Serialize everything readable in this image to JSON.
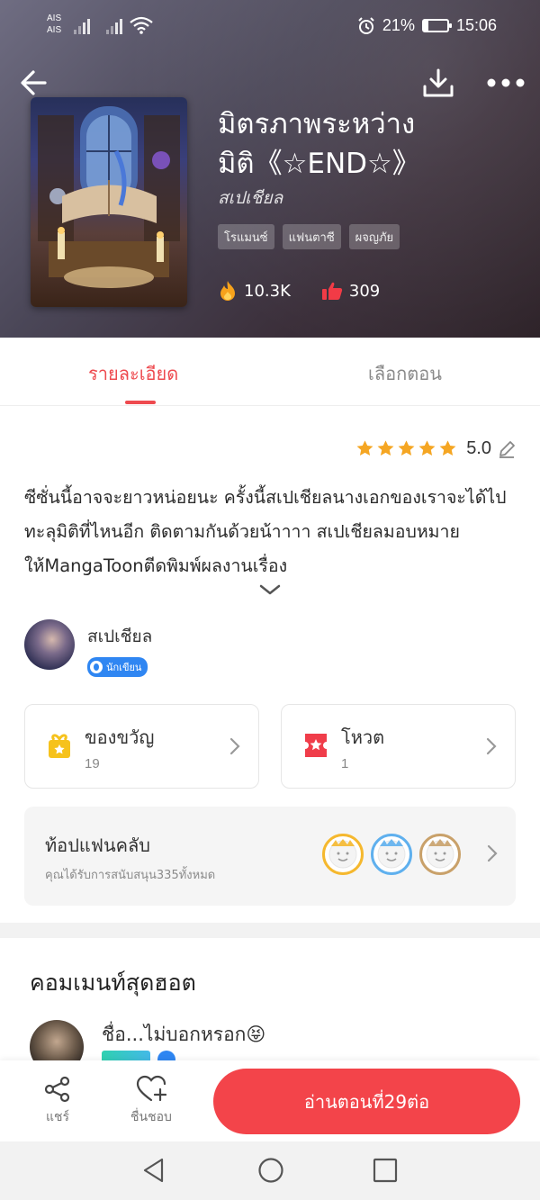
{
  "status_bar": {
    "carrier_1": "AIS",
    "carrier_2": "AIS",
    "battery": "21%",
    "battery_level": 0.21,
    "time": "15:06"
  },
  "header": {
    "back_icon": "back-arrow-icon",
    "download_icon": "download-icon",
    "more_icon": "more-icon"
  },
  "book": {
    "title_line1": "มิตรภาพระหว่าง",
    "title_line2": "มิติ《☆END☆》",
    "author": "สเปเชียล",
    "tags": [
      "โรแมนซ์",
      "แฟนตาซี",
      "ผจญภัย"
    ],
    "views": "10.3K",
    "likes": "309"
  },
  "tabs": {
    "details": "รายละเอียด",
    "episodes": "เลือกตอน"
  },
  "details": {
    "rating": "5.0",
    "rating_stars": 5,
    "description": "ซีซั่นนี้อาจจะยาวหน่อยนะ ครั้งนี้สเปเชียลนางเอกของเราจะได้ไปทะลุมิติที่ไหนอีก ติดตามกันด้วยน้าาาา สเปเชียลมอบหมายให้MangaToonตีดพิมพ์ผลงานเรื่อง"
  },
  "author_info": {
    "name": "สเปเชียล",
    "badge": "นักเขียน"
  },
  "cards": {
    "gift_label": "ของขวัญ",
    "gift_count": "19",
    "vote_label": "โหวต",
    "vote_count": "1"
  },
  "fanclub": {
    "title": "ท้อปแฟนคลับ",
    "subtitle": "คุณได้รับการสนับสนุน335ทั้งหมด"
  },
  "comments": {
    "title": "คอมเมนท์สุดฮอต",
    "first_comment": "ชื่อ...ไม่บอกหรอก😝"
  },
  "bottom_bar": {
    "share": "แชร์",
    "favorite": "ชื่นชอบ",
    "read_button": "อ่านตอนที่29ต่อ"
  },
  "colors": {
    "accent": "#ee4a4f",
    "read_button": "#f3444a",
    "star": "#f5a623"
  }
}
